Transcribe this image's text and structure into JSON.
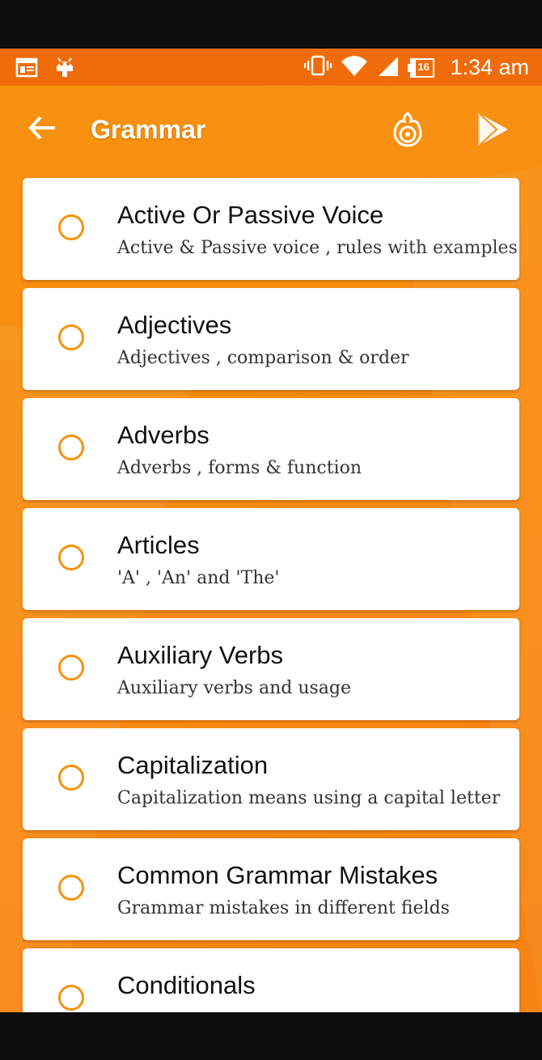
{
  "status_bar": {
    "time": "1:34 am",
    "battery_level": "16",
    "left_icons": [
      "calendar-icon",
      "android-debug-icon"
    ],
    "right_icons": [
      "vibrate-icon",
      "wifi-icon",
      "signal-icon",
      "battery-icon"
    ]
  },
  "toolbar": {
    "title": "Grammar",
    "back_icon": "arrow-left-icon",
    "actions": [
      "fire-disc-icon",
      "play-store-icon"
    ]
  },
  "colors": {
    "accent": "#f7920f",
    "status_bar": "#f06c0a",
    "card": "#ffffff"
  },
  "topics": [
    {
      "title": "Active Or Passive Voice",
      "subtitle": "Active & Passive voice , rules with examples"
    },
    {
      "title": "Adjectives",
      "subtitle": "Adjectives , comparison & order"
    },
    {
      "title": "Adverbs",
      "subtitle": "Adverbs , forms & function"
    },
    {
      "title": "Articles",
      "subtitle": "'A' , 'An' and 'The'"
    },
    {
      "title": "Auxiliary Verbs",
      "subtitle": "Auxiliary verbs and usage"
    },
    {
      "title": "Capitalization",
      "subtitle": "Capitalization means using a capital letter"
    },
    {
      "title": "Common Grammar Mistakes",
      "subtitle": "Grammar mistakes in different fields"
    },
    {
      "title": "Conditionals",
      "subtitle": ""
    }
  ]
}
